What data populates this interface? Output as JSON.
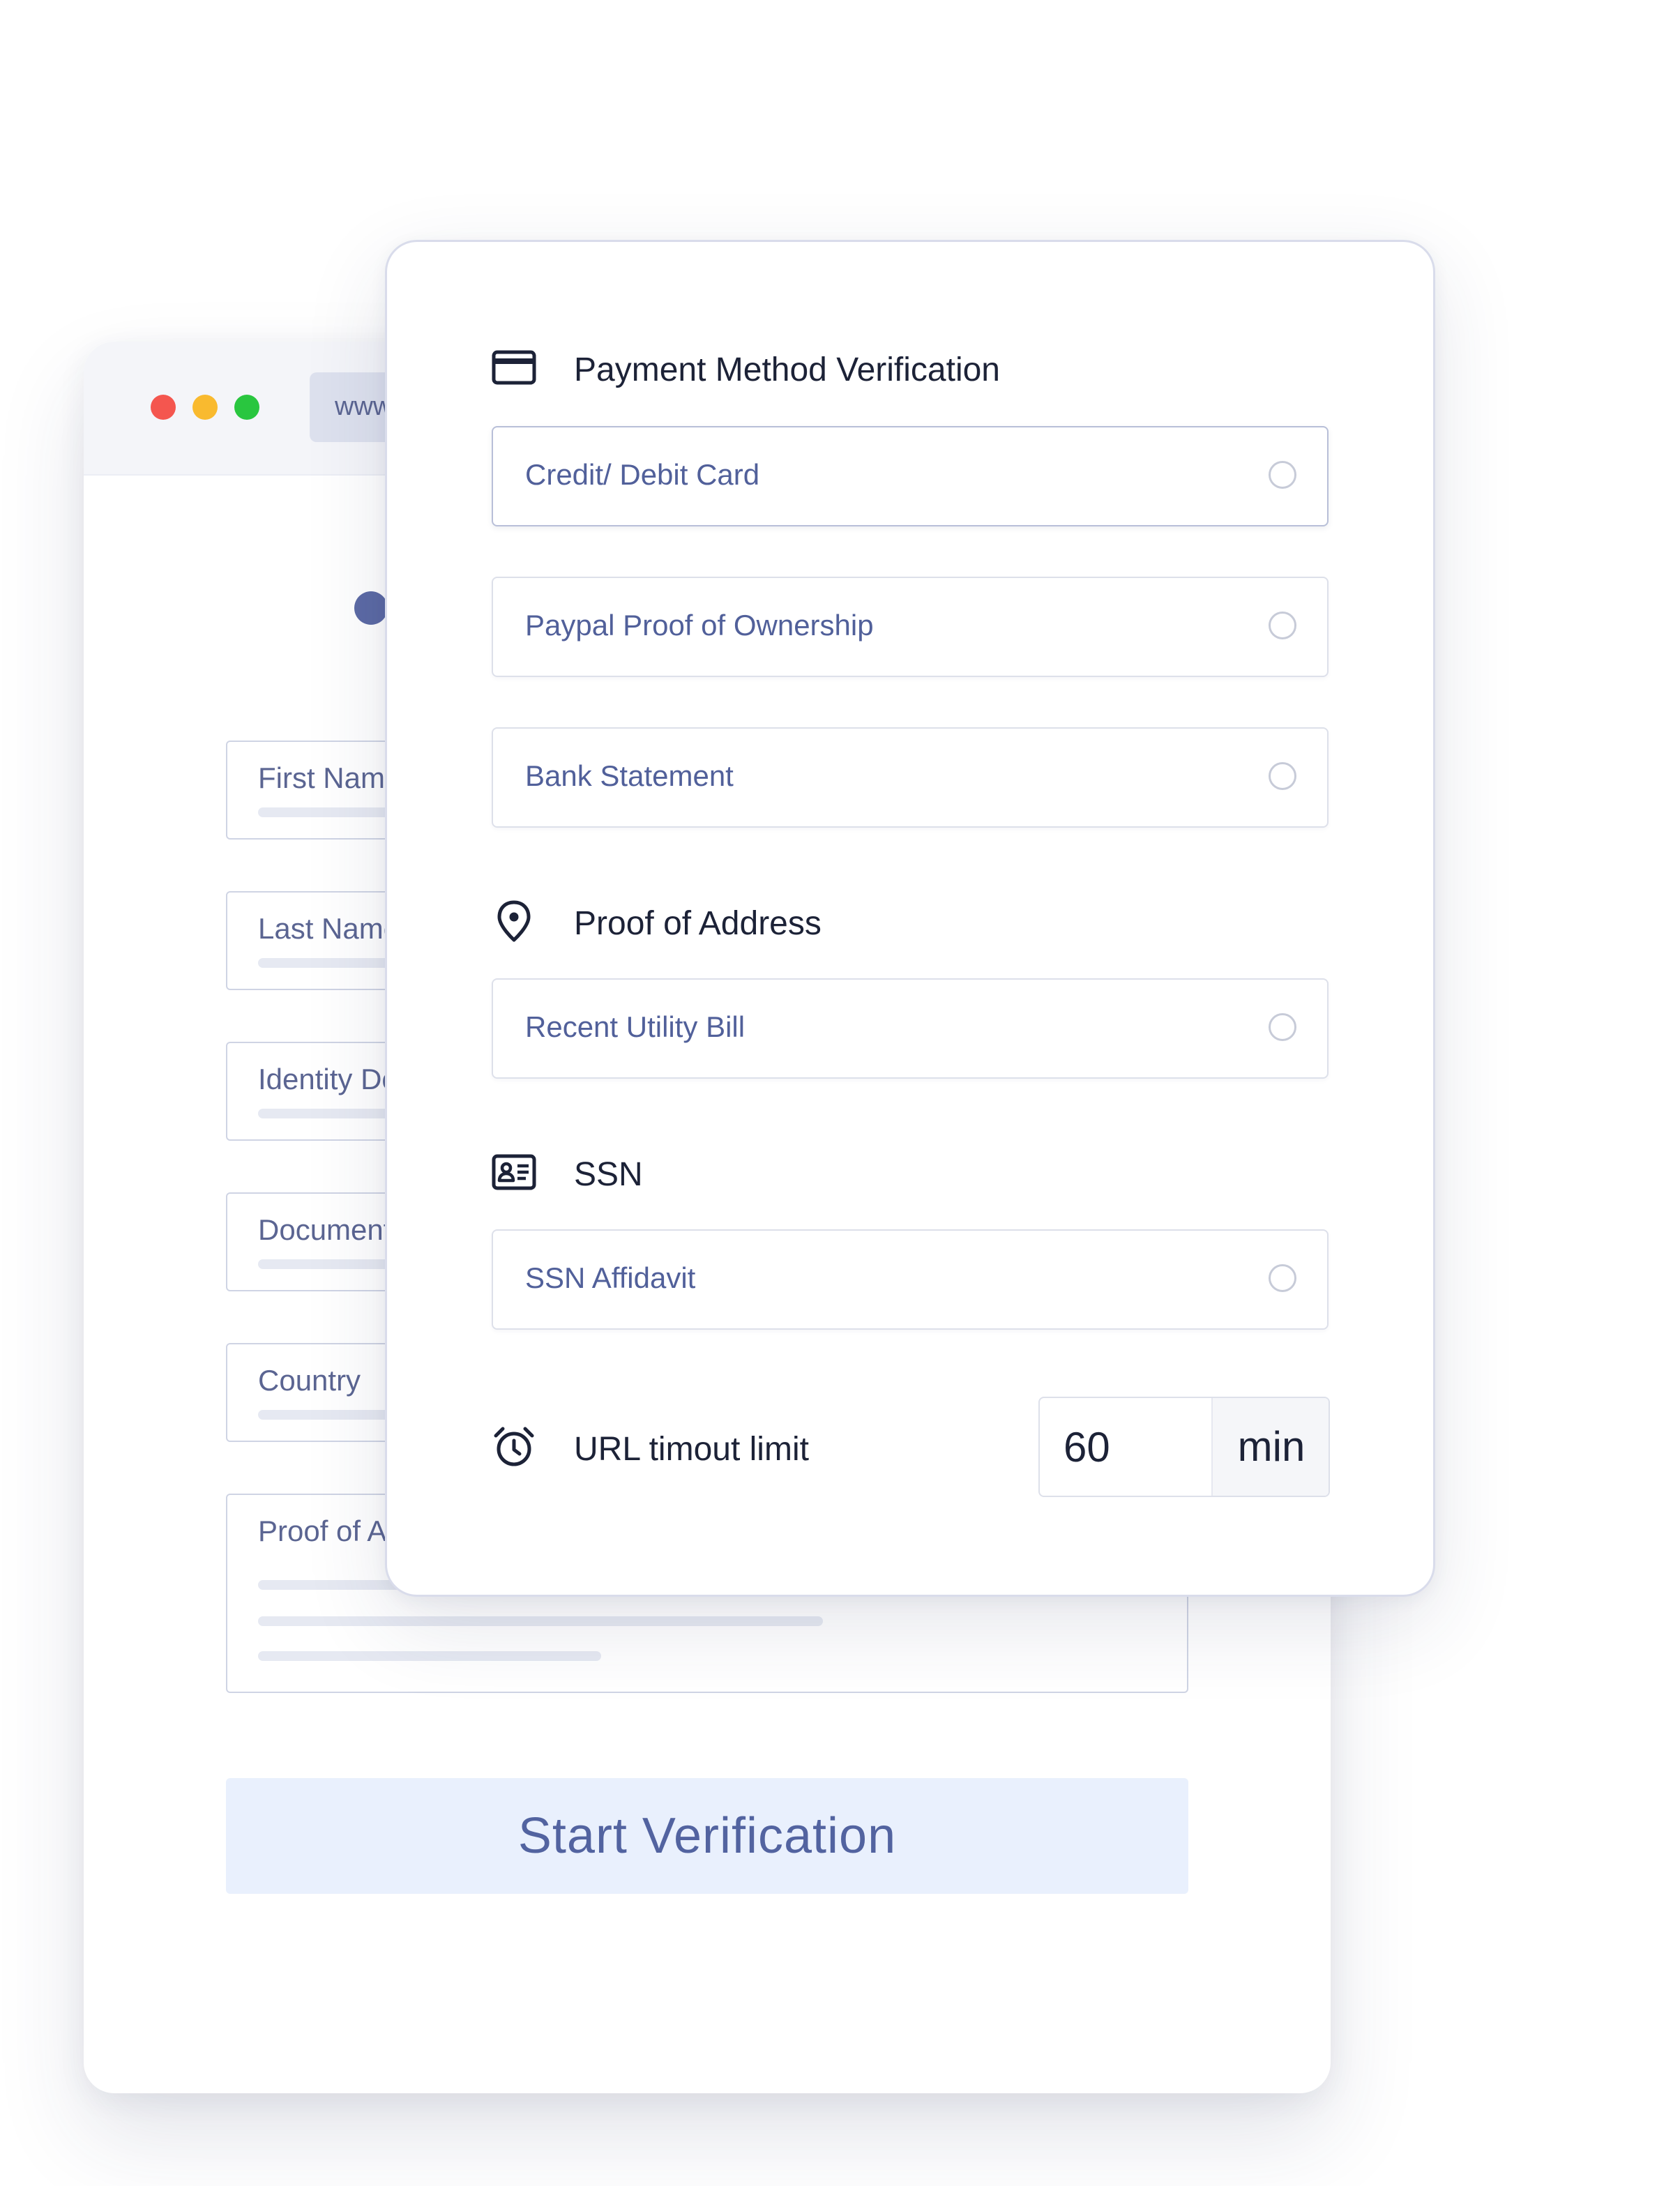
{
  "browser": {
    "url_text": "www.",
    "window_colors": {
      "close": "#f4564f",
      "minimize": "#f9ba2f",
      "maximize": "#29c63f"
    },
    "form_fields": [
      {
        "label": "First Name"
      },
      {
        "label": "Last Name"
      },
      {
        "label": "Identity Document"
      },
      {
        "label": "Document"
      },
      {
        "label": "Country"
      },
      {
        "label": "Proof of Address"
      }
    ],
    "start_button_label": "Start Verification",
    "accent_color": "#5c6aa5"
  },
  "card": {
    "payment": {
      "title": "Payment Method Verification",
      "icon": "credit-card-icon",
      "options": [
        {
          "label": "Credit/ Debit Card",
          "selected": false
        },
        {
          "label": "Paypal Proof of Ownership",
          "selected": false
        },
        {
          "label": "Bank Statement",
          "selected": false
        }
      ]
    },
    "address": {
      "title": "Proof of Address",
      "icon": "map-pin-icon",
      "options": [
        {
          "label": "Recent Utility Bill",
          "selected": false
        }
      ]
    },
    "ssn": {
      "title": "SSN",
      "icon": "id-card-icon",
      "options": [
        {
          "label": "SSN Affidavit",
          "selected": false
        }
      ]
    },
    "timeout": {
      "label": "URL timout limit",
      "icon": "alarm-clock-icon",
      "value": "60",
      "unit": "min"
    }
  }
}
